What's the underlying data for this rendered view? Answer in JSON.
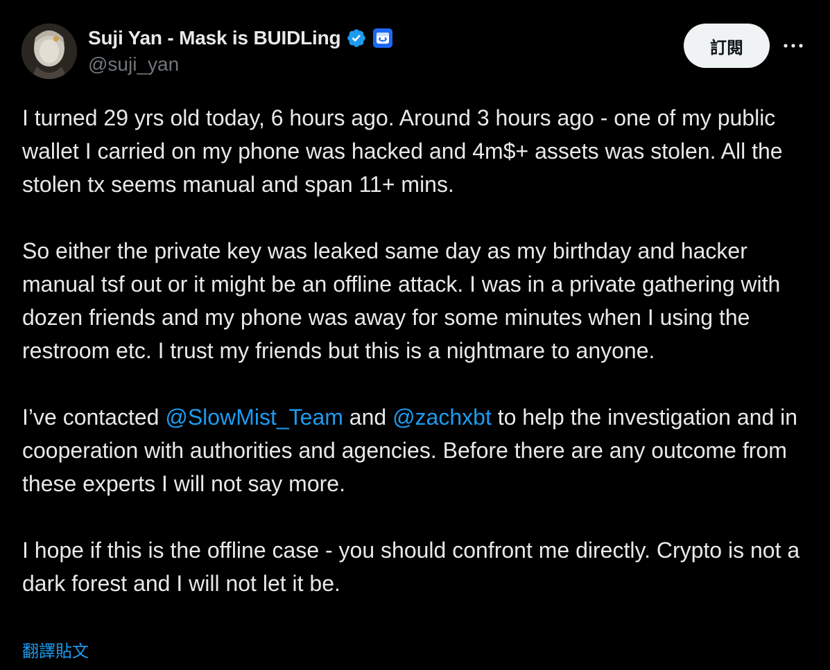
{
  "author": {
    "display_name": "Suji Yan - Mask is BUIDLing",
    "handle": "@suji_yan",
    "verified_icon": "verified-badge-icon",
    "affiliate_icon": "affiliate-badge-icon",
    "avatar": "avatar"
  },
  "actions": {
    "subscribe_label": "訂閱",
    "more_icon": "more-options-icon"
  },
  "tweet": {
    "p1": "I turned 29 yrs old today, 6 hours ago. Around 3 hours ago - one of my public wallet I carried on my phone was hacked and 4m$+ assets was stolen. All the stolen tx seems manual and span 11+ mins.",
    "p2": "So either the private key was leaked same day as my birthday and hacker manual tsf out or it might be an offline attack. I was in a private gathering with dozen friends and my phone was away for some minutes when I using the restroom etc. I trust my friends but this is a nightmare to anyone.",
    "p3_pre": "I’ve contacted ",
    "p3_mention1": "@SlowMist_Team",
    "p3_mid": " and ",
    "p3_mention2": "@zachxbt",
    "p3_post": " to help the investigation and in cooperation with authorities and agencies. Before there are any outcome from these experts I will not say more.",
    "p4": "I hope if this is the offline case - you should confront me directly. Crypto is not a dark forest and I will not let it be."
  },
  "translate_label": "翻譯貼文",
  "colors": {
    "background": "#000000",
    "text": "#e7e9ea",
    "secondary_text": "#71767b",
    "link": "#1d9bf0",
    "button_bg": "#eff3f4",
    "button_text": "#0f1419"
  }
}
